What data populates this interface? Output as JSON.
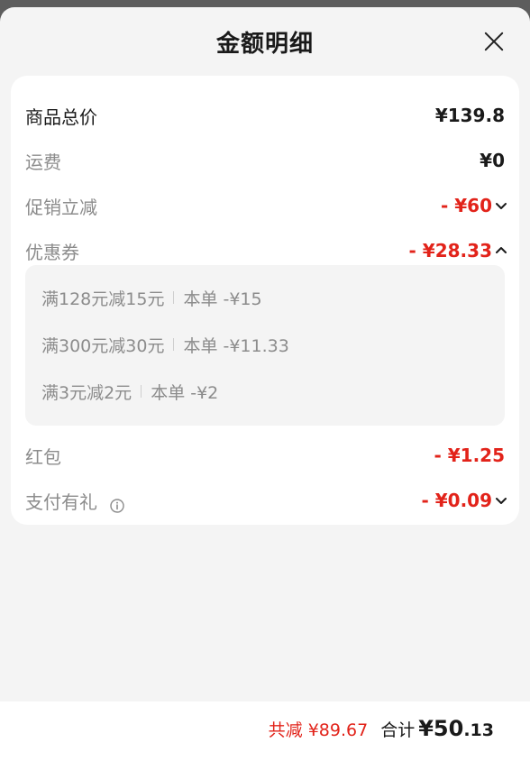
{
  "header": {
    "title": "金额明细"
  },
  "rows": {
    "goods_total": {
      "label": "商品总价",
      "value": "¥139.8"
    },
    "shipping": {
      "label": "运费",
      "value": "¥0"
    },
    "promo": {
      "label": "促销立减",
      "value": "- ¥60"
    },
    "coupon": {
      "label": "优惠券",
      "value": "- ¥28.33"
    },
    "red_packet": {
      "label": "红包",
      "value": "- ¥1.25"
    },
    "pay_gift": {
      "label": "支付有礼",
      "value": "- ¥0.09"
    }
  },
  "coupons": [
    {
      "rule": "满128元减15元",
      "amount": "本单 -¥15"
    },
    {
      "rule": "满300元减30元",
      "amount": "本单 -¥11.33"
    },
    {
      "rule": "满3元减2元",
      "amount": "本单 -¥2"
    }
  ],
  "footer": {
    "saved": "共减 ¥89.67",
    "total_label": "合计",
    "total_currency": "¥",
    "total_int": "50",
    "total_dec": ".13"
  },
  "colors": {
    "accent_red": "#e2231a",
    "muted_text": "#8c8c8c",
    "sheet_bg": "#f4f4f4"
  },
  "icons": [
    "close-icon",
    "chevron-down-icon",
    "chevron-up-icon",
    "info-icon"
  ]
}
